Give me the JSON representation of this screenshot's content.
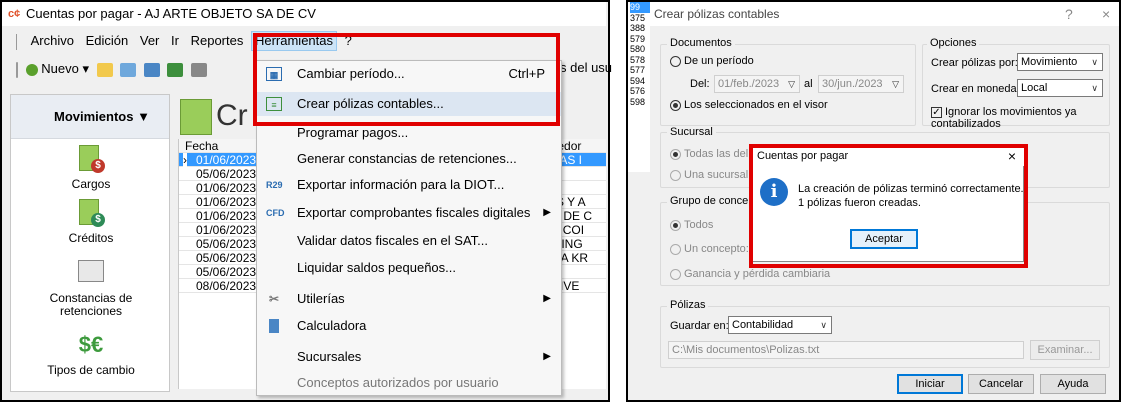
{
  "left": {
    "title": "Cuentas por pagar - AJ ARTE OBJETO SA DE CV",
    "menu": [
      "Archivo",
      "Edición",
      "Ver",
      "Ir",
      "Reportes",
      "Herramientas",
      "?"
    ],
    "toolbar": {
      "nuevo": "Nuevo",
      "user_fragment": "s del usu"
    },
    "sidebar": {
      "header": "Movimientos",
      "items": [
        "Cargos",
        "Créditos",
        "Constancias de retenciones",
        "Tipos de cambio"
      ]
    },
    "main_title_fragment": "Cr",
    "grid": {
      "header": "Fecha",
      "dates": [
        "01/06/2023",
        "05/06/2023",
        "01/06/2023",
        "01/06/2023",
        "01/06/2023",
        "01/06/2023",
        "05/06/2023",
        "05/06/2023",
        "05/06/2023",
        "08/06/2023"
      ],
      "right_header": "roveedor",
      "right_cells": [
        "DERAS I",
        "",
        "ICO",
        "AJES Y A",
        "Z SA DE C",
        "E LA COI",
        "RA SING",
        "RIELA KR",
        "",
        "RA LIVE"
      ]
    },
    "dropdown": {
      "items": [
        {
          "label": "Cambiar período...",
          "shortcut": "Ctrl+P"
        },
        {
          "label": "Crear pólizas contables..."
        },
        {
          "label": "Programar pagos..."
        },
        {
          "label": "Generar constancias de retenciones..."
        },
        {
          "label": "Exportar información para la DIOT...",
          "icon_text": "R29"
        },
        {
          "label": "Exportar comprobantes fiscales digitales",
          "icon_text": "CFD"
        },
        {
          "label": "Validar datos fiscales en el SAT..."
        },
        {
          "label": "Liquidar saldos pequeños..."
        },
        {
          "label": "Utilerías"
        },
        {
          "label": "Calculadora"
        },
        {
          "label": "Sucursales"
        },
        {
          "label": "Conceptos autorizados por usuario"
        }
      ]
    }
  },
  "right": {
    "strip_numbers": [
      "99",
      "375",
      "388",
      "579",
      "580",
      "578",
      "577",
      "594",
      "576",
      "598"
    ],
    "title": "Crear pólizas contables",
    "title_buttons": {
      "help": "?",
      "close": "×"
    },
    "documentos": {
      "label": "Documentos",
      "periodo": "De un período",
      "del_label": "Del:",
      "del_value": "01/feb./2023",
      "al_label": "al",
      "al_value": "30/jun./2023",
      "visor": "Los seleccionados en el visor"
    },
    "opciones": {
      "label": "Opciones",
      "crear_por_label": "Crear pólizas por:",
      "crear_por_value": "Movimiento",
      "moneda_label": "Crear en moneda:",
      "moneda_value": "Local",
      "ignorar": "Ignorar los movimientos ya contabilizados"
    },
    "sucursal": {
      "label": "Sucursal",
      "todas": "Todas las del",
      "una": "Una sucursal"
    },
    "grupo": {
      "label": "Grupo de concep",
      "todos": "Todos",
      "un": "Un concepto:",
      "ganancia": "Ganancia y pérdida cambiaria"
    },
    "polizas": {
      "label": "Pólizas",
      "guardar_label": "Guardar en:",
      "guardar_value": "Contabilidad",
      "path": "C:\\Mis documentos\\Polizas.txt",
      "examinar": "Examinar..."
    },
    "buttons": {
      "iniciar": "Iniciar",
      "cancelar": "Cancelar",
      "ayuda": "Ayuda"
    },
    "msgbox": {
      "title": "Cuentas por pagar",
      "close": "×",
      "line1": "La creación de pólizas terminó correctamente.",
      "line2": "1 pólizas fueron creadas.",
      "ok": "Aceptar"
    }
  },
  "colors": {
    "highlight_box": "#e00000",
    "selection": "#3399ff"
  }
}
